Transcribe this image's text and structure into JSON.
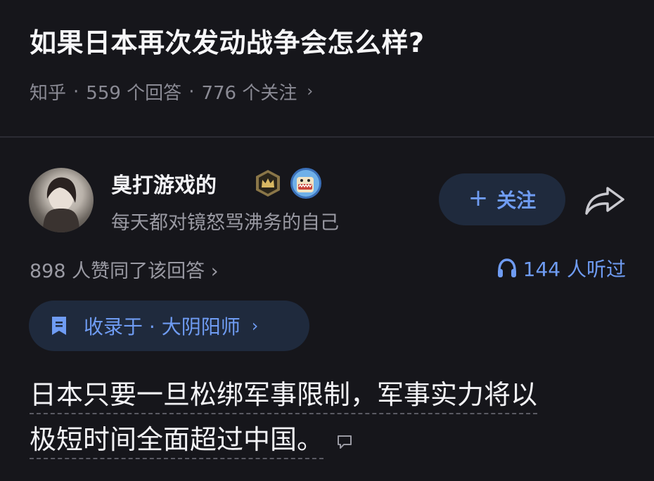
{
  "question": {
    "title": "如果日本再次发动战争会怎么样?",
    "source": "知乎",
    "answers_count": "559 个回答",
    "followers_count": "776 个关注",
    "separator": "·",
    "chevron": "›"
  },
  "author": {
    "name": "臭打游戏的",
    "bio": "每天都对镜怒骂沸务的自己",
    "avatar_icon": "avatar-photo",
    "badges": [
      "crown-icon",
      "sticker-icon"
    ]
  },
  "actions": {
    "follow_plus": "+",
    "follow_label": "关注",
    "share_icon": "share-icon"
  },
  "stats": {
    "upvote_text": "898 人赞同了该回答 ›",
    "listen_text": "144 人听过",
    "listen_icon": "headphones-icon"
  },
  "collection": {
    "label": "收录于 · 大阴阳师",
    "chevron": "›",
    "icon": "bookmark-icon"
  },
  "answer": {
    "line1": "日本只要一旦松绑军事限制，军事实力将以",
    "line2": "极短时间全面超过中国。"
  },
  "colors": {
    "background": "#16161b",
    "accent": "#6f9cf3",
    "chip_bg": "#1f2a3d",
    "muted_text": "#9a9aa3"
  }
}
